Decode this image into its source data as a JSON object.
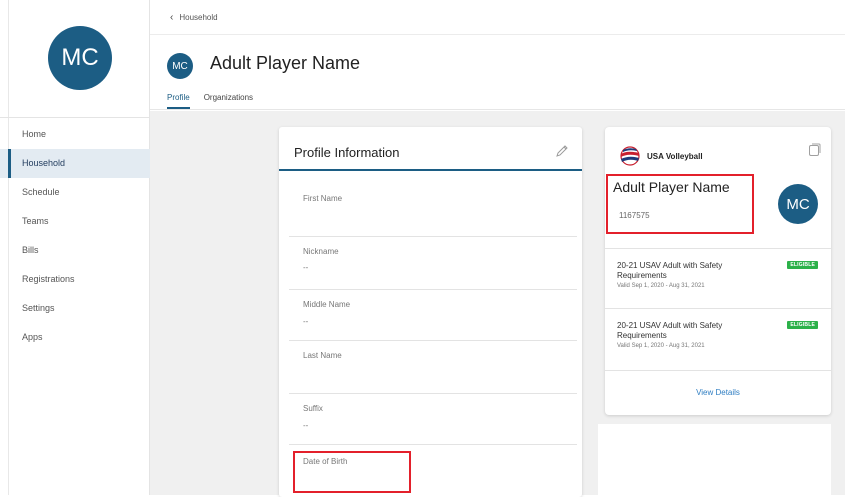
{
  "user": {
    "initials": "MC"
  },
  "sidebar": {
    "items": [
      {
        "label": "Home",
        "active": false
      },
      {
        "label": "Household",
        "active": true
      },
      {
        "label": "Schedule",
        "active": false
      },
      {
        "label": "Teams",
        "active": false
      },
      {
        "label": "Bills",
        "active": false
      },
      {
        "label": "Registrations",
        "active": false
      },
      {
        "label": "Settings",
        "active": false
      },
      {
        "label": "Apps",
        "active": false
      }
    ]
  },
  "header": {
    "back_label": "Household",
    "title": "Adult Player Name",
    "tabs": [
      {
        "label": "Profile",
        "active": true
      },
      {
        "label": "Organizations",
        "active": false
      }
    ]
  },
  "profile": {
    "title": "Profile Information",
    "fields": [
      {
        "label": "First Name",
        "value": ""
      },
      {
        "label": "Nickname",
        "value": "--"
      },
      {
        "label": "Middle Name",
        "value": "--"
      },
      {
        "label": "Last Name",
        "value": ""
      },
      {
        "label": "Suffix",
        "value": "--"
      },
      {
        "label": "Date of Birth",
        "value": ""
      }
    ]
  },
  "badge": {
    "org_name": "USA Volleyball",
    "player_name": "Adult Player Name",
    "player_id": "1167575",
    "memberships": [
      {
        "title": "20-21 USAV Adult with Safety Requirements",
        "valid": "Valid Sep 1, 2020 - Aug 31, 2021",
        "status": "ELIGIBLE"
      },
      {
        "title": "20-21 USAV Adult with Safety Requirements",
        "valid": "Valid Sep 1, 2020 - Aug 31, 2021",
        "status": "ELIGIBLE"
      }
    ],
    "view_details": "View Details"
  },
  "colors": {
    "brand": "#1c5d84",
    "eligible": "#2db14a",
    "highlight": "#e3202b",
    "link": "#2f7ec2"
  }
}
